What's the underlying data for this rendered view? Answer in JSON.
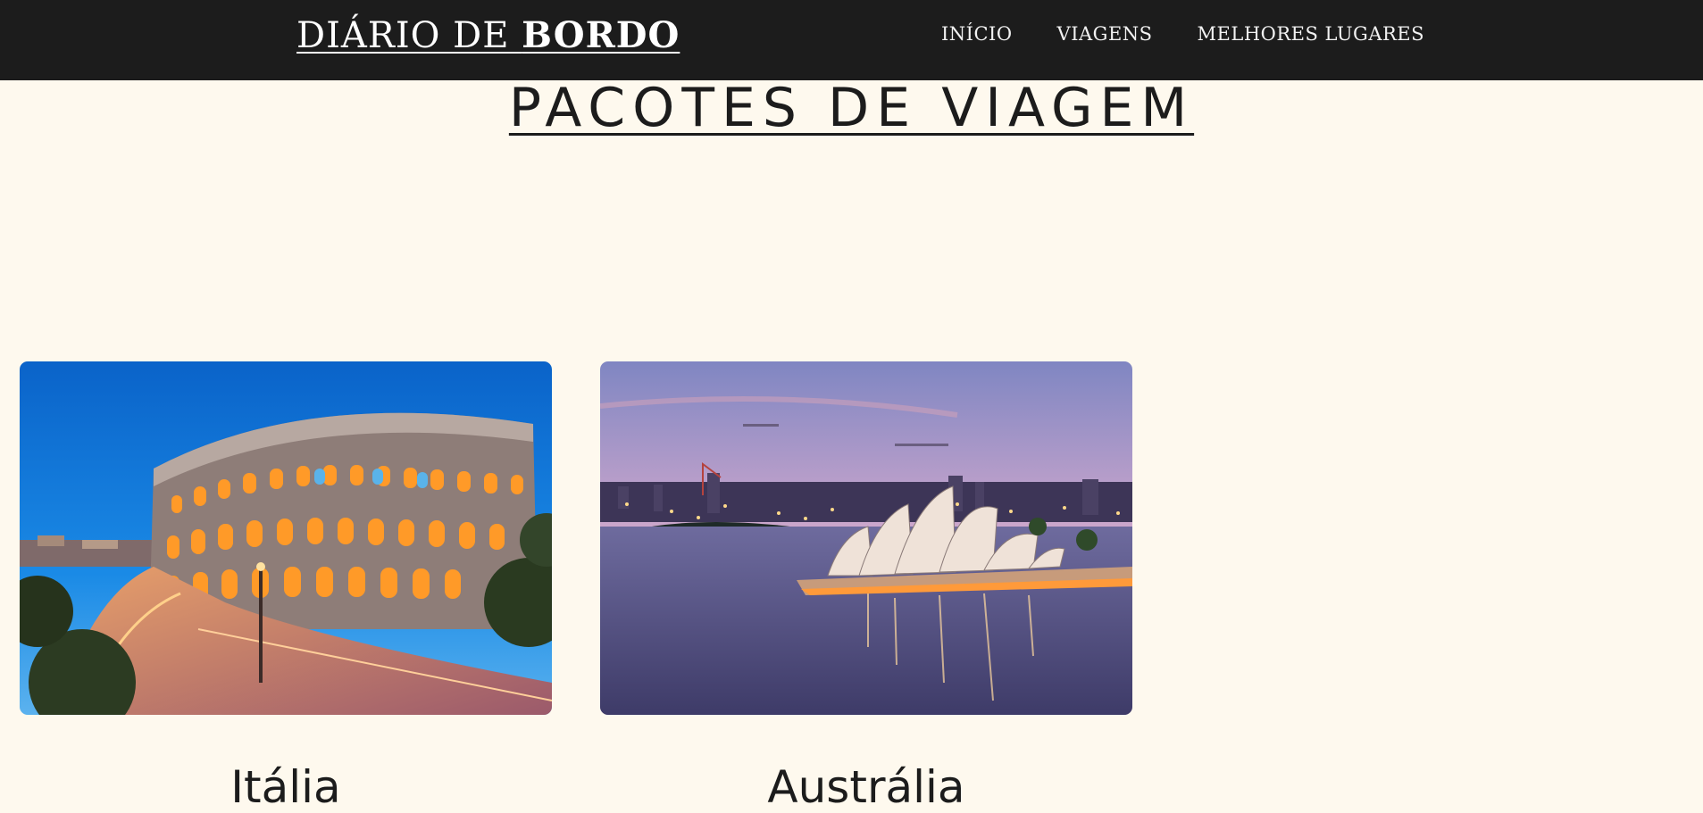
{
  "header": {
    "brand_part1": "DIÁRIO DE ",
    "brand_part2": "BORDO",
    "nav": [
      {
        "label": "INÍCIO"
      },
      {
        "label": "VIAGENS"
      },
      {
        "label": "MELHORES LUGARES"
      }
    ]
  },
  "main": {
    "title": "PACOTES DE VIAGEM",
    "cards": [
      {
        "label": "Itália",
        "image": "colosseum-night-photo"
      },
      {
        "label": "Austrália",
        "image": "sydney-opera-house-dusk-photo"
      }
    ]
  },
  "colors": {
    "navbar_bg": "#1c1c1c",
    "page_bg": "#fef9ee",
    "text_dark": "#1c1c1c",
    "nav_text": "#f2f2f2"
  }
}
